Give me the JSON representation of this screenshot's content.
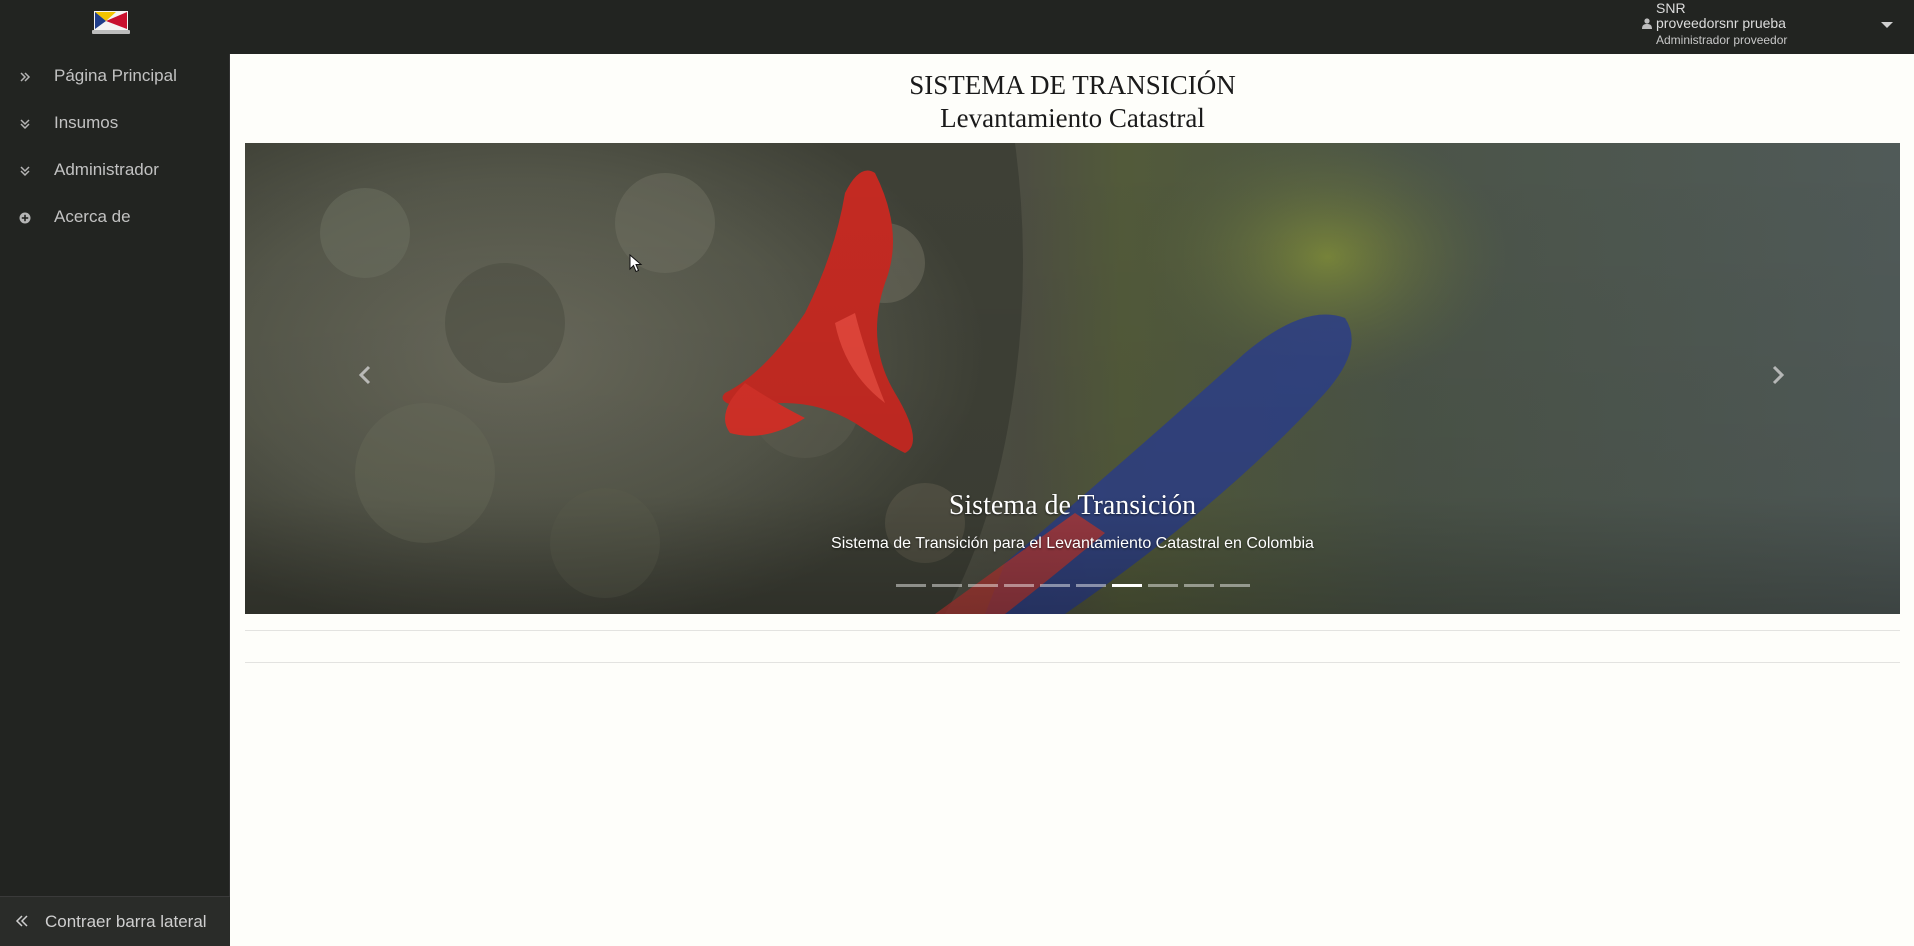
{
  "header": {
    "logo_icon": "app-logo-icon",
    "user": {
      "organization": "SNR",
      "name": "proveedorsnr prueba",
      "role": "Administrador proveedor",
      "icons": [
        "user-icon",
        "caret-down-icon"
      ]
    }
  },
  "sidebar": {
    "items": [
      {
        "label": "Página Principal",
        "icon": "double-chevron-right-icon"
      },
      {
        "label": "Insumos",
        "icon": "double-chevron-down-icon"
      },
      {
        "label": "Administrador",
        "icon": "double-chevron-down-icon"
      },
      {
        "label": "Acerca de",
        "icon": "plus-circle-icon"
      }
    ],
    "collapse_label": "Contraer barra lateral",
    "collapse_icon": "double-chevron-left-icon"
  },
  "main": {
    "title_line1": "SISTEMA DE TRANSICIÓN",
    "title_line2": "Levantamiento Catastral",
    "carousel": {
      "caption_title": "Sistema de Transición",
      "caption_text": "Sistema de Transición para el Levantamiento Catastral en Colombia",
      "slide_count": 10,
      "active_index": 6,
      "nav_icons": [
        "chevron-left-icon",
        "chevron-right-icon"
      ]
    }
  },
  "colors": {
    "topbar": "#222421",
    "sidebar": "#222421",
    "page_background": "#fefefa",
    "sidebar_text": "#c2c2c2"
  }
}
